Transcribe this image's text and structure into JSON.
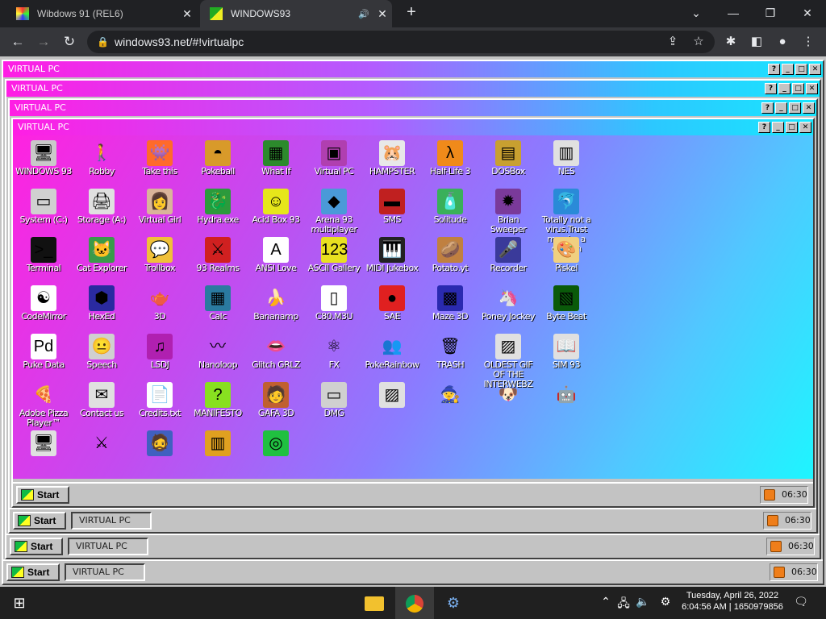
{
  "browser": {
    "tabs": [
      {
        "title": "Wibdows 91 (REL6)",
        "active": false
      },
      {
        "title": "WINDOWS93",
        "active": true
      }
    ],
    "url": "windows93.net/#!virtualpc"
  },
  "virtualpc": {
    "window_title": "VIRTUAL PC",
    "title_buttons": [
      "?",
      "_",
      "□",
      "✕"
    ],
    "start_label": "Start",
    "task_label": "VIRTUAL PC",
    "clock": "06:30"
  },
  "desktop_icons": [
    {
      "label": "WINDOWS 93",
      "glyph": "🖥",
      "color": "#c9c9c9"
    },
    {
      "label": "Robby",
      "glyph": "🚶",
      "color": "transparent"
    },
    {
      "label": "Take this",
      "glyph": "👾",
      "color": "#ff6a2a"
    },
    {
      "label": "Pokeball",
      "glyph": "◓",
      "color": "#d89a2a"
    },
    {
      "label": "What If",
      "glyph": "▦",
      "color": "#2c8a2c"
    },
    {
      "label": "Virtual PC",
      "glyph": "▣",
      "color": "#b03fb0"
    },
    {
      "label": "HAMPSTER",
      "glyph": "🐹",
      "color": "#e8e8e8"
    },
    {
      "label": "Half-Life 3",
      "glyph": "λ",
      "color": "#f08a1a"
    },
    {
      "label": "DOSBox",
      "glyph": "▤",
      "color": "#c8a030"
    },
    {
      "label": "NES",
      "glyph": "▥",
      "color": "#e0e0e0"
    },
    {
      "label": "System (C:)",
      "glyph": "▭",
      "color": "#d0d0d0"
    },
    {
      "label": "Storage (A:)",
      "glyph": "🖨",
      "color": "#e0e0e0"
    },
    {
      "label": "Virtual Girl",
      "glyph": "👩",
      "color": "#d9b49a"
    },
    {
      "label": "Hydra.exe",
      "glyph": "🐉",
      "color": "#2c9a3c"
    },
    {
      "label": "Acid Box 93",
      "glyph": "☺",
      "color": "#e6e61a"
    },
    {
      "label": "Arena 93 multiplayer",
      "glyph": "◆",
      "color": "#4a9ad8"
    },
    {
      "label": "SMS",
      "glyph": "▬",
      "color": "#c02020"
    },
    {
      "label": "Solitude",
      "glyph": "🧴",
      "color": "#3ab05a"
    },
    {
      "label": "Brian Sweeper",
      "glyph": "✹",
      "color": "#7a3a9a"
    },
    {
      "label": "Totally not a virus.Trust me...im a dolphin",
      "glyph": "🐬",
      "color": "#2a8ad8"
    },
    {
      "label": "Terminal",
      "glyph": ">_",
      "color": "#111111"
    },
    {
      "label": "Cat Explorer",
      "glyph": "🐱",
      "color": "#3a9a4a"
    },
    {
      "label": "Trollbox",
      "glyph": "💬",
      "color": "#f0c03a"
    },
    {
      "label": "93 Realms",
      "glyph": "⚔",
      "color": "#d02020"
    },
    {
      "label": "ANSI Love",
      "glyph": "A",
      "color": "#ffffff"
    },
    {
      "label": "ASCII Gallery",
      "glyph": "123",
      "color": "#e8e020"
    },
    {
      "label": "MIDI Jukebox",
      "glyph": "🎹",
      "color": "#222222"
    },
    {
      "label": "Potato.yt",
      "glyph": "🥔",
      "color": "#c08040"
    },
    {
      "label": "Recorder",
      "glyph": "🎤",
      "color": "#3a3a9a"
    },
    {
      "label": "Piskel",
      "glyph": "🎨",
      "color": "#f0d080"
    },
    {
      "label": "CodeMirror",
      "glyph": "☯",
      "color": "#ffffff"
    },
    {
      "label": "HexEd",
      "glyph": "⬢",
      "color": "#2a2aa0"
    },
    {
      "label": "3D",
      "glyph": "🫖",
      "color": "transparent"
    },
    {
      "label": "Calc",
      "glyph": "▦",
      "color": "#2a7aa0"
    },
    {
      "label": "Bananamp",
      "glyph": "🍌",
      "color": "transparent"
    },
    {
      "label": "C80.M3U",
      "glyph": "▯",
      "color": "#ffffff"
    },
    {
      "label": "SAE",
      "glyph": "●",
      "color": "#e02020"
    },
    {
      "label": "Maze 3D",
      "glyph": "▩",
      "color": "#2a2ab0"
    },
    {
      "label": "Poney Jockey",
      "glyph": "🦄",
      "color": "transparent"
    },
    {
      "label": "Byte Beat",
      "glyph": "▧",
      "color": "#0a5a0a"
    },
    {
      "label": "Puke Data",
      "glyph": "Pd",
      "color": "#ffffff"
    },
    {
      "label": "Speech",
      "glyph": "😐",
      "color": "#d0d0d0"
    },
    {
      "label": "LSDJ",
      "glyph": "♫",
      "color": "#b020b0"
    },
    {
      "label": "Nanoloop",
      "glyph": "〰",
      "color": "transparent"
    },
    {
      "label": "Glitch GRLZ",
      "glyph": "👄",
      "color": "transparent"
    },
    {
      "label": "FX",
      "glyph": "⚛",
      "color": "transparent"
    },
    {
      "label": "PokeRainbow",
      "glyph": "👥",
      "color": "transparent"
    },
    {
      "label": "TRASH",
      "glyph": "🗑",
      "color": "transparent"
    },
    {
      "label": "OLDEST GIF OF THE INTERWEBZ",
      "glyph": "▨",
      "color": "#e0e0e0"
    },
    {
      "label": "SIM 93",
      "glyph": "📖",
      "color": "#e0e0e0"
    },
    {
      "label": "Adobe Pizza Player™",
      "glyph": "🍕",
      "color": "transparent"
    },
    {
      "label": "Contact us",
      "glyph": "✉",
      "color": "#e0e0e0"
    },
    {
      "label": "Credits.txt",
      "glyph": "📄",
      "color": "#ffffff"
    },
    {
      "label": "MANIFESTO",
      "glyph": "?",
      "color": "#88e020"
    },
    {
      "label": "GAFA 3D",
      "glyph": "🧑",
      "color": "#c06030"
    },
    {
      "label": "DMG",
      "glyph": "▭",
      "color": "#d0d0d0"
    },
    {
      "label": "",
      "glyph": "▨",
      "color": "#e0e0e0"
    },
    {
      "label": "",
      "glyph": "🧙",
      "color": "transparent"
    },
    {
      "label": "",
      "glyph": "🐶",
      "color": "transparent"
    },
    {
      "label": "",
      "glyph": "🤖",
      "color": "transparent"
    },
    {
      "label": "",
      "glyph": "🖥",
      "color": "#e0e0e0"
    },
    {
      "label": "",
      "glyph": "⚔",
      "color": "transparent"
    },
    {
      "label": "",
      "glyph": "🧔",
      "color": "#4060c0"
    },
    {
      "label": "",
      "glyph": "▥",
      "color": "#e0a020"
    },
    {
      "label": "",
      "glyph": "◎",
      "color": "#20c040"
    }
  ],
  "windows_taskbar": {
    "datetime_line1": "Tuesday, April 26, 2022",
    "datetime_line2": "6:04:56 AM | 1650979856"
  }
}
